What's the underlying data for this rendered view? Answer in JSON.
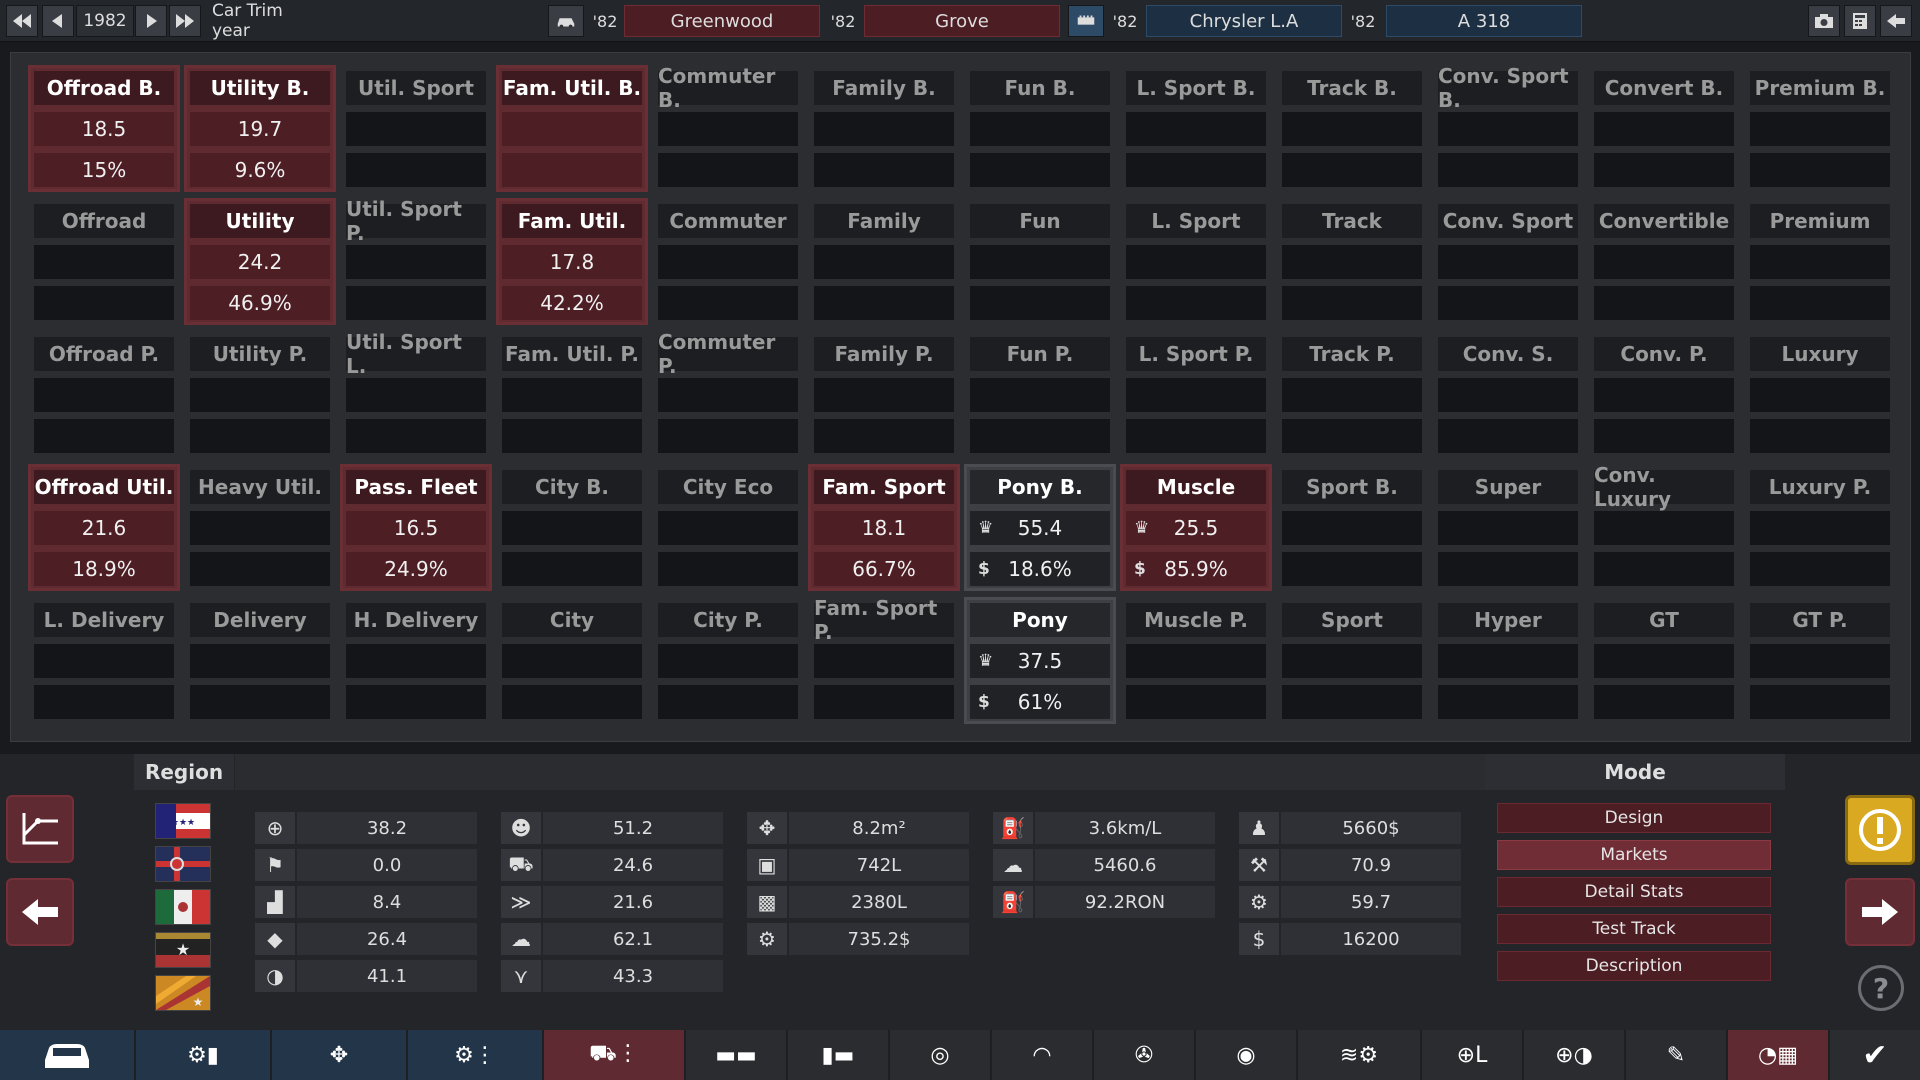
{
  "topbar": {
    "year": "1982",
    "mode_label": "Car Trim year",
    "compare": [
      {
        "yr": "'82",
        "name": "Greenwood"
      },
      {
        "yr": "'82",
        "name": "Grove"
      },
      {
        "yr": "'82",
        "name": "Chrysler L.A"
      },
      {
        "yr": "'82",
        "name": "A 318"
      }
    ]
  },
  "grid": [
    [
      {
        "name": "Offroad B.",
        "v1": "18.5",
        "v2": "15%",
        "state": "active"
      },
      {
        "name": "Utility B.",
        "v1": "19.7",
        "v2": "9.6%",
        "state": "active"
      },
      {
        "name": "Util. Sport",
        "v1": "",
        "v2": "",
        "state": ""
      },
      {
        "name": "Fam. Util. B.",
        "v1": "",
        "v2": "",
        "state": "active"
      },
      {
        "name": "Commuter B.",
        "v1": "",
        "v2": "",
        "state": ""
      },
      {
        "name": "Family B.",
        "v1": "",
        "v2": "",
        "state": ""
      },
      {
        "name": "Fun B.",
        "v1": "",
        "v2": "",
        "state": ""
      },
      {
        "name": "L. Sport B.",
        "v1": "",
        "v2": "",
        "state": ""
      },
      {
        "name": "Track B.",
        "v1": "",
        "v2": "",
        "state": ""
      },
      {
        "name": "Conv. Sport B.",
        "v1": "",
        "v2": "",
        "state": ""
      },
      {
        "name": "Convert B.",
        "v1": "",
        "v2": "",
        "state": ""
      },
      {
        "name": "Premium B.",
        "v1": "",
        "v2": "",
        "state": ""
      }
    ],
    [
      {
        "name": "Offroad",
        "v1": "",
        "v2": "",
        "state": ""
      },
      {
        "name": "Utility",
        "v1": "24.2",
        "v2": "46.9%",
        "state": "active"
      },
      {
        "name": "Util. Sport P.",
        "v1": "",
        "v2": "",
        "state": ""
      },
      {
        "name": "Fam. Util.",
        "v1": "17.8",
        "v2": "42.2%",
        "state": "active"
      },
      {
        "name": "Commuter",
        "v1": "",
        "v2": "",
        "state": ""
      },
      {
        "name": "Family",
        "v1": "",
        "v2": "",
        "state": ""
      },
      {
        "name": "Fun",
        "v1": "",
        "v2": "",
        "state": ""
      },
      {
        "name": "L. Sport",
        "v1": "",
        "v2": "",
        "state": ""
      },
      {
        "name": "Track",
        "v1": "",
        "v2": "",
        "state": ""
      },
      {
        "name": "Conv. Sport",
        "v1": "",
        "v2": "",
        "state": ""
      },
      {
        "name": "Convertible",
        "v1": "",
        "v2": "",
        "state": ""
      },
      {
        "name": "Premium",
        "v1": "",
        "v2": "",
        "state": ""
      }
    ],
    [
      {
        "name": "Offroad P.",
        "v1": "",
        "v2": "",
        "state": ""
      },
      {
        "name": "Utility P.",
        "v1": "",
        "v2": "",
        "state": ""
      },
      {
        "name": "Util. Sport L.",
        "v1": "",
        "v2": "",
        "state": ""
      },
      {
        "name": "Fam. Util. P.",
        "v1": "",
        "v2": "",
        "state": ""
      },
      {
        "name": "Commuter P.",
        "v1": "",
        "v2": "",
        "state": ""
      },
      {
        "name": "Family P.",
        "v1": "",
        "v2": "",
        "state": ""
      },
      {
        "name": "Fun P.",
        "v1": "",
        "v2": "",
        "state": ""
      },
      {
        "name": "L. Sport P.",
        "v1": "",
        "v2": "",
        "state": ""
      },
      {
        "name": "Track P.",
        "v1": "",
        "v2": "",
        "state": ""
      },
      {
        "name": "Conv. S.",
        "v1": "",
        "v2": "",
        "state": ""
      },
      {
        "name": "Conv. P.",
        "v1": "",
        "v2": "",
        "state": ""
      },
      {
        "name": "Luxury",
        "v1": "",
        "v2": "",
        "state": ""
      }
    ],
    [
      {
        "name": "Offroad Util.",
        "v1": "21.6",
        "v2": "18.9%",
        "state": "active"
      },
      {
        "name": "Heavy Util.",
        "v1": "",
        "v2": "",
        "state": ""
      },
      {
        "name": "Pass. Fleet",
        "v1": "16.5",
        "v2": "24.9%",
        "state": "active"
      },
      {
        "name": "City B.",
        "v1": "",
        "v2": "",
        "state": ""
      },
      {
        "name": "City Eco",
        "v1": "",
        "v2": "",
        "state": ""
      },
      {
        "name": "Fam. Sport",
        "v1": "18.1",
        "v2": "66.7%",
        "state": "active"
      },
      {
        "name": "Pony B.",
        "v1": "55.4",
        "v2": "18.6%",
        "state": "grey",
        "icons": true
      },
      {
        "name": "Muscle",
        "v1": "25.5",
        "v2": "85.9%",
        "state": "active",
        "icons": true
      },
      {
        "name": "Sport B.",
        "v1": "",
        "v2": "",
        "state": ""
      },
      {
        "name": "Super",
        "v1": "",
        "v2": "",
        "state": ""
      },
      {
        "name": "Conv. Luxury",
        "v1": "",
        "v2": "",
        "state": ""
      },
      {
        "name": "Luxury P.",
        "v1": "",
        "v2": "",
        "state": ""
      }
    ],
    [
      {
        "name": "L. Delivery",
        "v1": "",
        "v2": "",
        "state": ""
      },
      {
        "name": "Delivery",
        "v1": "",
        "v2": "",
        "state": ""
      },
      {
        "name": "H. Delivery",
        "v1": "",
        "v2": "",
        "state": ""
      },
      {
        "name": "City",
        "v1": "",
        "v2": "",
        "state": ""
      },
      {
        "name": "City P.",
        "v1": "",
        "v2": "",
        "state": ""
      },
      {
        "name": "Fam. Sport P.",
        "v1": "",
        "v2": "",
        "state": ""
      },
      {
        "name": "Pony",
        "v1": "37.5",
        "v2": "61%",
        "state": "grey",
        "icons": true
      },
      {
        "name": "Muscle P.",
        "v1": "",
        "v2": "",
        "state": ""
      },
      {
        "name": "Sport",
        "v1": "",
        "v2": "",
        "state": ""
      },
      {
        "name": "Hyper",
        "v1": "",
        "v2": "",
        "state": ""
      },
      {
        "name": "GT",
        "v1": "",
        "v2": "",
        "state": ""
      },
      {
        "name": "GT P.",
        "v1": "",
        "v2": "",
        "state": ""
      }
    ]
  ],
  "cell_icons": {
    "v1": "♛",
    "v2": "$"
  },
  "region": {
    "label": "Region"
  },
  "stats": [
    [
      {
        "icon": "steering-wheel-icon",
        "value": "38.2"
      },
      {
        "icon": "checkered-flag-icon",
        "value": "0.0"
      },
      {
        "icon": "seat-icon",
        "value": "8.4"
      },
      {
        "icon": "diamond-icon",
        "value": "26.4"
      },
      {
        "icon": "safety-icon",
        "value": "41.1"
      }
    ],
    [
      {
        "icon": "passengers-icon",
        "value": "51.2"
      },
      {
        "icon": "cargo-car-icon",
        "value": "24.6"
      },
      {
        "icon": "car-speed-icon",
        "value": "21.6"
      },
      {
        "icon": "smog-icon",
        "value": "62.1"
      },
      {
        "icon": "offroad-icon",
        "value": "43.3"
      }
    ],
    [
      {
        "icon": "dimension-icon",
        "value": "8.2m²"
      },
      {
        "icon": "cargo-box-icon",
        "value": "742L"
      },
      {
        "icon": "passenger-volume-icon",
        "value": "2380L"
      },
      {
        "icon": "service-cost-icon",
        "value": "735.2$"
      }
    ],
    [
      {
        "icon": "fuel-economy-icon",
        "value": "3.6km/L"
      },
      {
        "icon": "emissions-cloud-icon",
        "value": "5460.6"
      },
      {
        "icon": "fuel-pump-icon",
        "value": "92.2RON"
      }
    ],
    [
      {
        "icon": "worker-cost-icon",
        "value": "5660$"
      },
      {
        "icon": "anvil-icon",
        "value": "70.9"
      },
      {
        "icon": "gears-icon",
        "value": "59.7"
      },
      {
        "icon": "dollar-icon",
        "value": "16200"
      }
    ]
  ],
  "mode": {
    "label": "Mode",
    "buttons": [
      "Design",
      "Markets",
      "Detail Stats",
      "Test Track",
      "Description"
    ],
    "selected": 1
  },
  "colors": {
    "accent_red": "#5f2a31",
    "accent_blue": "#233548",
    "warning": "#d9a921"
  }
}
